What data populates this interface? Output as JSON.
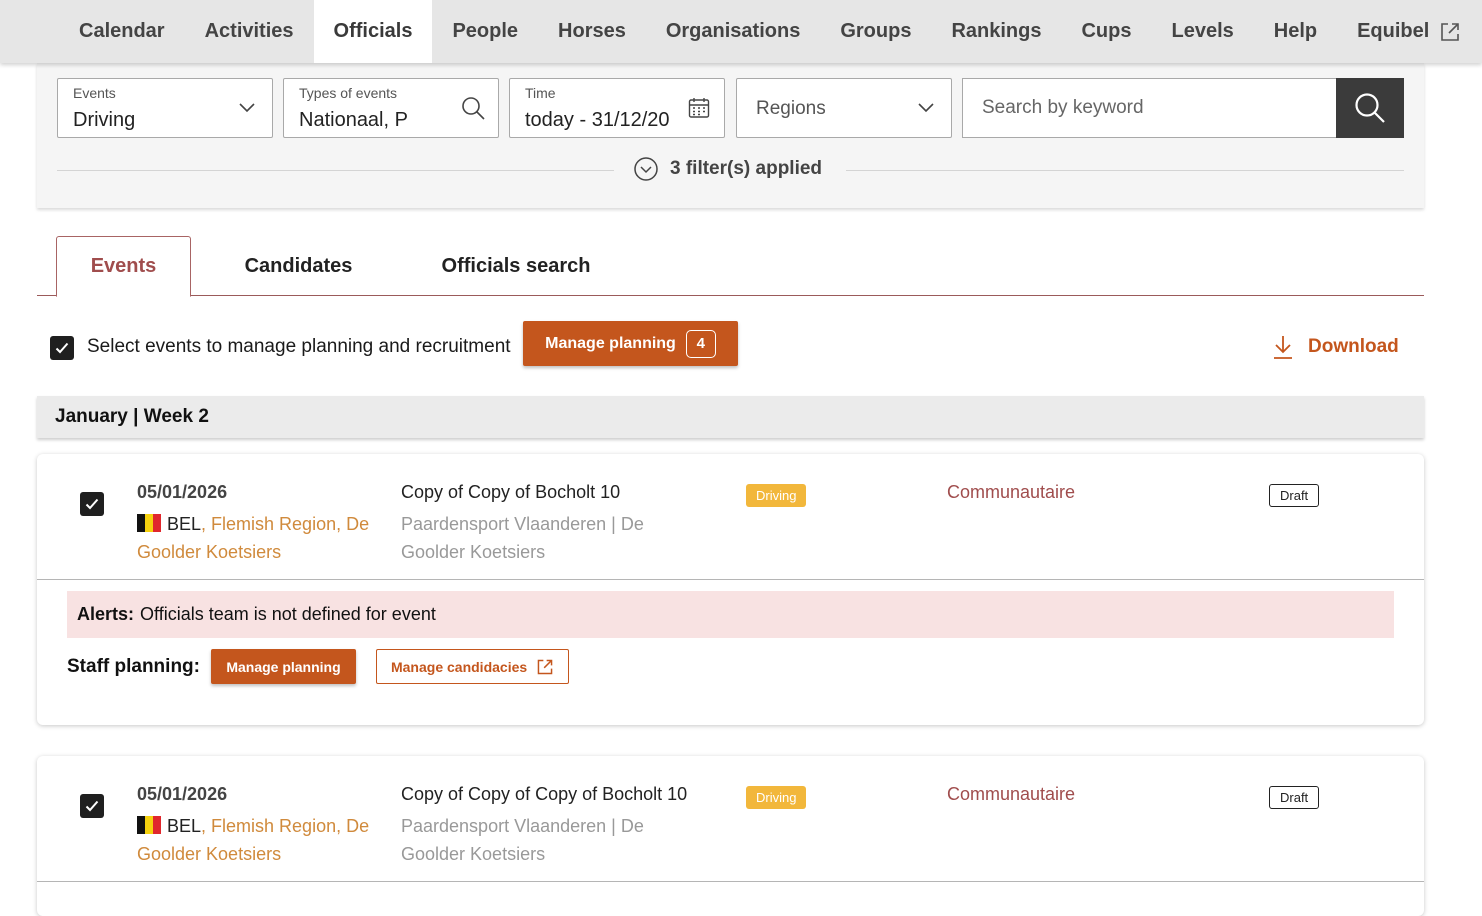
{
  "nav": {
    "items": [
      {
        "label": "Calendar",
        "active": false
      },
      {
        "label": "Activities",
        "active": false
      },
      {
        "label": "Officials",
        "active": true
      },
      {
        "label": "People",
        "active": false
      },
      {
        "label": "Horses",
        "active": false
      },
      {
        "label": "Organisations",
        "active": false
      },
      {
        "label": "Groups",
        "active": false
      },
      {
        "label": "Rankings",
        "active": false
      },
      {
        "label": "Cups",
        "active": false
      },
      {
        "label": "Levels",
        "active": false
      },
      {
        "label": "Help",
        "active": false
      },
      {
        "label": "Equibel",
        "active": false,
        "external": true
      }
    ]
  },
  "filters": {
    "events": {
      "label": "Events",
      "value": "Driving"
    },
    "types": {
      "label": "Types of events",
      "value": "Nationaal, P"
    },
    "time": {
      "label": "Time",
      "value": "today - 31/12/20"
    },
    "regions": {
      "placeholder": "Regions"
    },
    "search": {
      "placeholder": "Search by keyword",
      "value": ""
    },
    "summary": "3 filter(s) applied"
  },
  "tabs": [
    {
      "label": "Events",
      "active": true
    },
    {
      "label": "Candidates",
      "active": false
    },
    {
      "label": "Officials search",
      "active": false
    }
  ],
  "selection": {
    "checked": true,
    "text": "Select events to manage planning and recruitment",
    "manage_label": "Manage planning",
    "manage_count": "4",
    "download_label": "Download"
  },
  "week_header": "January | Week 2",
  "events": [
    {
      "checked": true,
      "date": "05/01/2026",
      "country": "BEL",
      "location": ", Flemish Region, De Goolder Koetsiers",
      "name": "Copy of Copy of Bocholt 10",
      "organiser": "Paardensport Vlaanderen | De Goolder Koetsiers",
      "discipline": "Driving",
      "level": "Communautaire",
      "status": "Draft",
      "alert_label": "Alerts:",
      "alert_text": "Officials team is not defined for event",
      "staff_label": "Staff planning:",
      "manage_planning_label": "Manage planning",
      "manage_candidacies_label": "Manage candidacies"
    },
    {
      "checked": true,
      "date": "05/01/2026",
      "country": "BEL",
      "location": ", Flemish Region, De Goolder Koetsiers",
      "name": "Copy of Copy of Copy of Bocholt 10",
      "organiser": "Paardensport Vlaanderen | De Goolder Koetsiers",
      "discipline": "Driving",
      "level": "Communautaire",
      "status": "Draft"
    }
  ],
  "colors": {
    "accent": "#c4561d",
    "tab_active": "#a04d4d",
    "driving_badge": "#f2b73b",
    "location_link": "#d08a3c",
    "alert_bg": "#f8e2e2"
  },
  "icons": {
    "dropdown": "chevron-down-icon",
    "search": "search-icon",
    "calendar": "calendar-icon",
    "filters_toggle": "chevron-circle-down-icon",
    "download": "download-icon",
    "external": "external-link-icon",
    "check": "check-icon",
    "flag": "belgium-flag-icon"
  }
}
